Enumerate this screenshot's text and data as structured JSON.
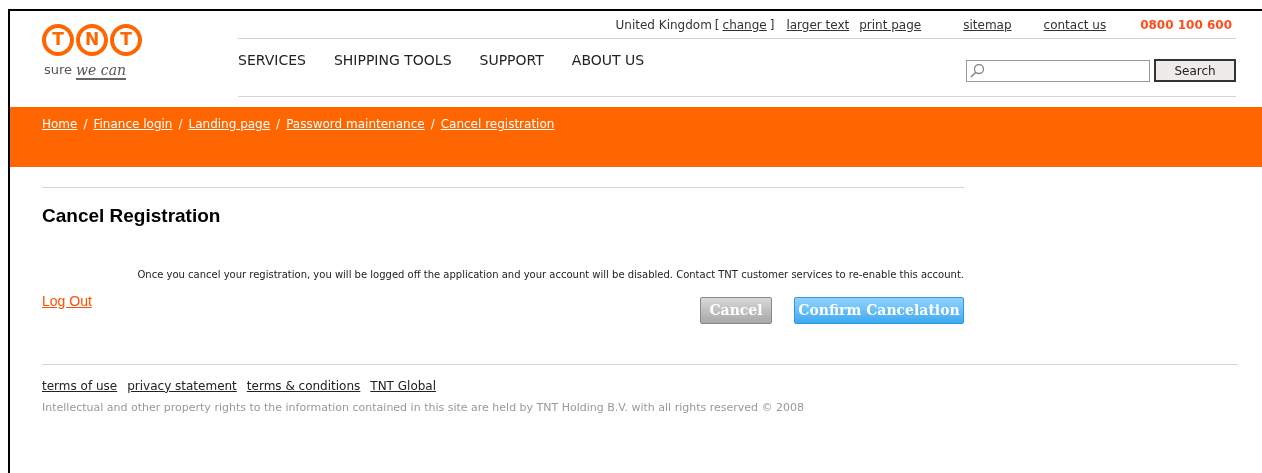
{
  "logo": {
    "letters": [
      "T",
      "N",
      "T"
    ],
    "tagline": "sure",
    "tagline_script": "we can"
  },
  "top_bar": {
    "country": "United Kingdom",
    "change_open": "[",
    "change": "change",
    "change_close": "]",
    "links": [
      "larger text",
      "print page",
      "sitemap",
      "contact us"
    ],
    "phone": "0800 100 600"
  },
  "nav": [
    "SERVICES",
    "SHIPPING TOOLS",
    "SUPPORT",
    "ABOUT US"
  ],
  "search": {
    "button": "Search"
  },
  "breadcrumb": [
    "Home",
    "Finance login",
    "Landing page",
    "Password maintenance",
    "Cancel registration"
  ],
  "breadcrumb_separator": "/",
  "heading": "Cancel Registration",
  "message": "Once you cancel your registration, you will be logged off the application and your account will be disabled. Contact TNT customer services to re-enable this account.",
  "logout": "Log Out",
  "buttons": [
    {
      "label": "Cancel",
      "kind": "secondary"
    },
    {
      "label": "Confirm Cancelation",
      "kind": "primary"
    }
  ],
  "footer": {
    "links": [
      "terms of use",
      "privacy statement",
      "terms & conditions",
      "TNT Global"
    ],
    "copyright": "Intellectual and other property rights to the information contained in this site are held by TNT Holding B.V. with all rights reserved © 2008"
  }
}
